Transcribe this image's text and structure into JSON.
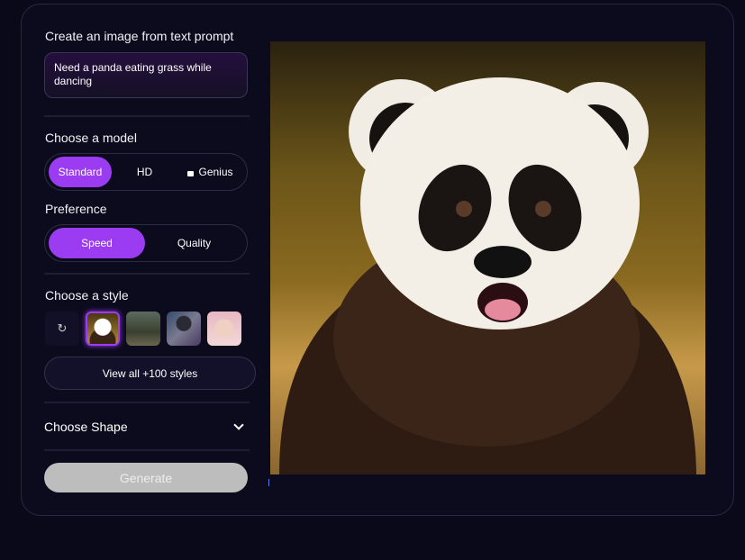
{
  "panel": {
    "prompt_heading": "Create an image from text prompt",
    "prompt_value": "Need a panda eating grass while dancing",
    "model_heading": "Choose a model",
    "models": [
      {
        "label": "Standard",
        "selected": true
      },
      {
        "label": "HD",
        "selected": false
      },
      {
        "label": "Genius",
        "selected": false,
        "locked": true
      }
    ],
    "preference_heading": "Preference",
    "preferences": [
      {
        "label": "Speed",
        "selected": true
      },
      {
        "label": "Quality",
        "selected": false
      }
    ],
    "style_heading": "Choose a style",
    "styles": [
      "none",
      "panda",
      "forest",
      "robot",
      "anime-girl"
    ],
    "selected_style": "panda",
    "view_all_label": "View all +100 styles",
    "shape_heading": "Choose Shape",
    "generate_label": "Generate"
  },
  "colors": {
    "accent": "#9b3cf2",
    "background": "#0a0919",
    "generate_disabled": "#bdbdbd"
  }
}
